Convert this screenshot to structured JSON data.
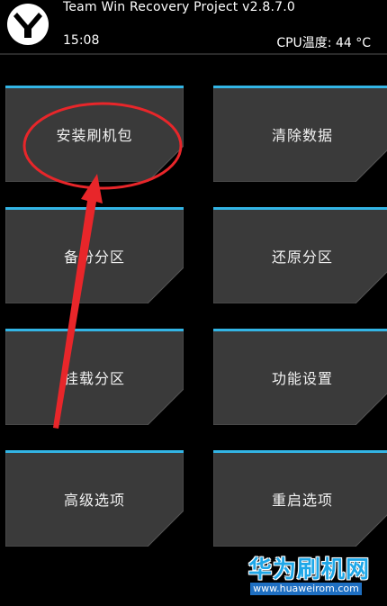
{
  "header": {
    "title": "Team Win Recovery Project  v2.8.7.0",
    "time": "15:08",
    "cpu_temp": "CPU温度: 44 °C"
  },
  "tiles": [
    {
      "label": "安装刷机包"
    },
    {
      "label": "清除数据"
    },
    {
      "label": "备份分区"
    },
    {
      "label": "还原分区"
    },
    {
      "label": "挂载分区"
    },
    {
      "label": "功能设置"
    },
    {
      "label": "高级选项"
    },
    {
      "label": "重启选项"
    }
  ],
  "watermark": {
    "cn": "华为刷机网",
    "url": "www.huaweirom.com"
  },
  "colors": {
    "accent": "#33b5e5",
    "tile": "#3a3a3a",
    "annotation": "#e8262a",
    "background": "#000000"
  }
}
